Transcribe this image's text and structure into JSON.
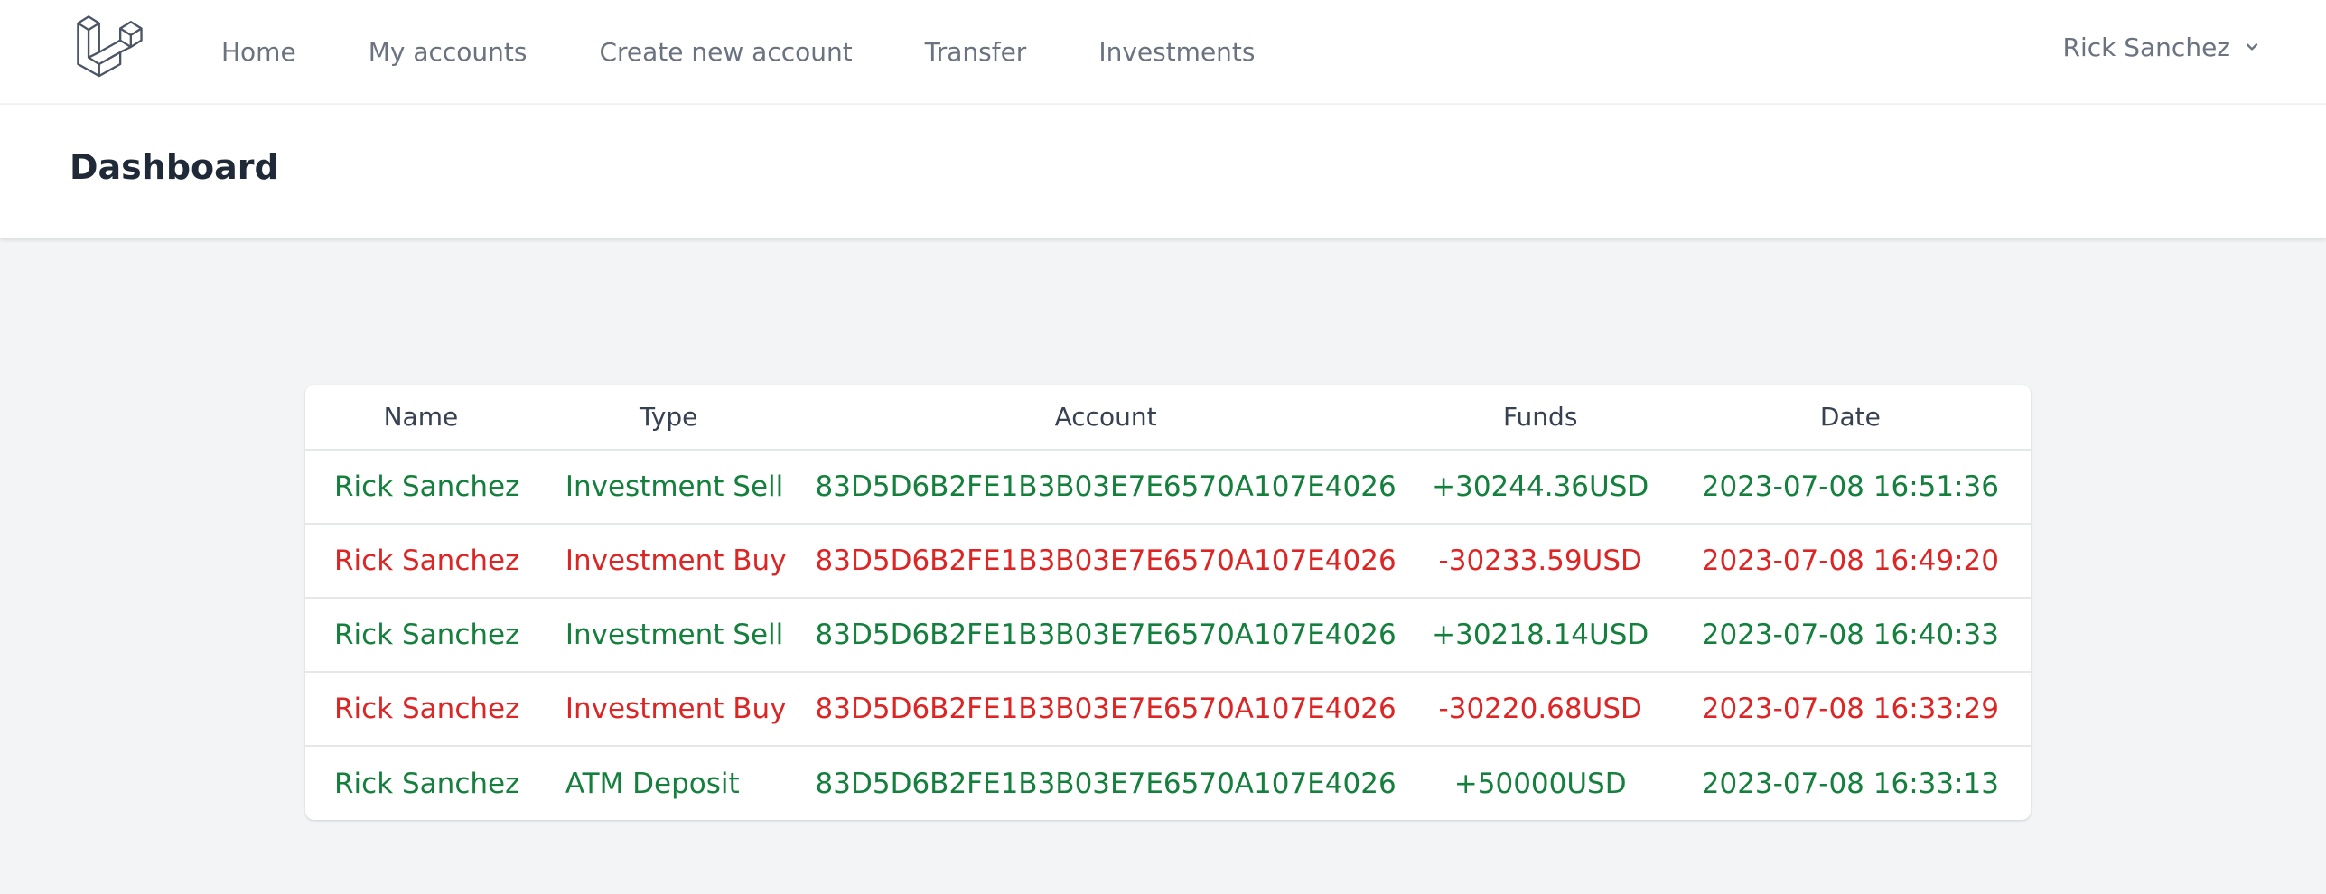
{
  "nav": {
    "links": [
      "Home",
      "My accounts",
      "Create new account",
      "Transfer",
      "Investments"
    ],
    "user_name": "Rick Sanchez"
  },
  "header": {
    "title": "Dashboard"
  },
  "table": {
    "columns": [
      "Name",
      "Type",
      "Account",
      "Funds",
      "Date"
    ],
    "rows": [
      {
        "name": "Rick Sanchez",
        "type": "Investment Sell",
        "account": "83D5D6B2FE1B3B03E7E6570A107E4026",
        "funds": "+30244.36USD",
        "date": "2023-07-08 16:51:36",
        "kind": "credit"
      },
      {
        "name": "Rick Sanchez",
        "type": "Investment Buy",
        "account": "83D5D6B2FE1B3B03E7E6570A107E4026",
        "funds": "-30233.59USD",
        "date": "2023-07-08 16:49:20",
        "kind": "debit"
      },
      {
        "name": "Rick Sanchez",
        "type": "Investment Sell",
        "account": "83D5D6B2FE1B3B03E7E6570A107E4026",
        "funds": "+30218.14USD",
        "date": "2023-07-08 16:40:33",
        "kind": "credit"
      },
      {
        "name": "Rick Sanchez",
        "type": "Investment Buy",
        "account": "83D5D6B2FE1B3B03E7E6570A107E4026",
        "funds": "-30220.68USD",
        "date": "2023-07-08 16:33:29",
        "kind": "debit"
      },
      {
        "name": "Rick Sanchez",
        "type": "ATM Deposit",
        "account": "83D5D6B2FE1B3B03E7E6570A107E4026",
        "funds": "+50000USD",
        "date": "2023-07-08 16:33:13",
        "kind": "credit"
      }
    ]
  },
  "colors": {
    "credit": "#15803d",
    "debit": "#dc2626"
  },
  "icons": {
    "logo": "laravel-logo-icon",
    "user_menu": "chevron-down-icon"
  }
}
